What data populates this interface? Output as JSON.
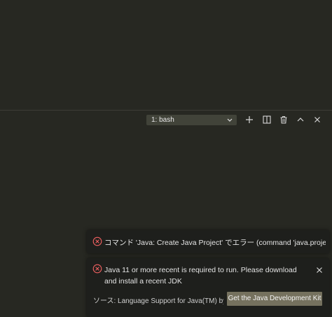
{
  "terminal_toolbar": {
    "selected_terminal": "1: bash",
    "icons": [
      "plus-icon",
      "split-icon",
      "trash-icon",
      "chevron-up-icon",
      "close-icon"
    ]
  },
  "notifications": [
    {
      "message": "コマンド 'Java: Create Java Project' でエラー (command 'java.project.cr...",
      "icon": "error-circle-icon"
    },
    {
      "message": "Java 11 or more recent is required to run. Please download and install a recent JDK",
      "source": "ソース: Language Support for Java(TM) by ...",
      "action_label": "Get the Java Development Kit",
      "icon": "error-circle-icon"
    }
  ],
  "colors": {
    "background": "#272822",
    "toast_background": "#1e1f1c",
    "button": "#75715e",
    "error": "#f06060"
  }
}
